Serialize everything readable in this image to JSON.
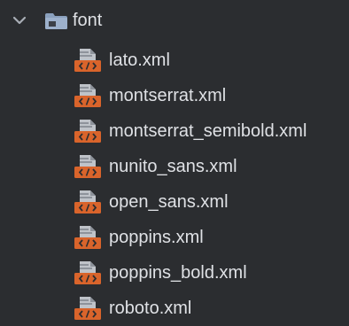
{
  "tree": {
    "folder": {
      "name": "font",
      "expanded": true,
      "icon": "folder-icon"
    },
    "files": [
      {
        "name": "lato.xml",
        "icon": "xml-file-icon"
      },
      {
        "name": "montserrat.xml",
        "icon": "xml-file-icon"
      },
      {
        "name": "montserrat_semibold.xml",
        "icon": "xml-file-icon"
      },
      {
        "name": "nunito_sans.xml",
        "icon": "xml-file-icon"
      },
      {
        "name": "open_sans.xml",
        "icon": "xml-file-icon"
      },
      {
        "name": "poppins.xml",
        "icon": "xml-file-icon"
      },
      {
        "name": "poppins_bold.xml",
        "icon": "xml-file-icon"
      },
      {
        "name": "roboto.xml",
        "icon": "xml-file-icon"
      }
    ]
  },
  "colors": {
    "background": "#2b2d30",
    "text": "#dfe1e5",
    "folder_icon": "#8aa0bd",
    "xml_badge": "#d9642b",
    "file_sheet": "#bfc3c9"
  }
}
